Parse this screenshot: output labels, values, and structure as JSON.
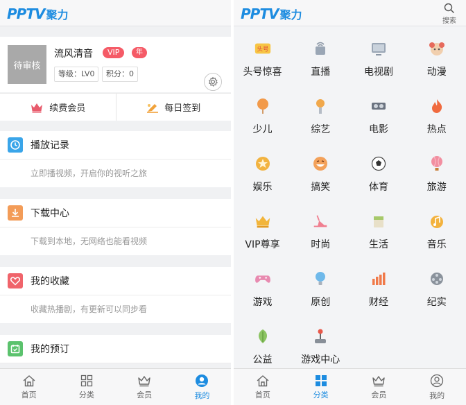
{
  "left": {
    "logo": {
      "brand": "PPTV",
      "sub": "聚力"
    },
    "profile": {
      "avatar_text": "待审核",
      "username": "流风清音",
      "vip_badge": "VIP",
      "year_badge": "年",
      "level": "等级：LV0",
      "points": "积分：0"
    },
    "actions": [
      {
        "label": "续费会员",
        "icon": "crown-icon"
      },
      {
        "label": "每日签到",
        "icon": "checkin-icon"
      }
    ],
    "sections": [
      {
        "title": "播放记录",
        "desc": "立即播视频，开启你的视听之旅",
        "icon": "clock-icon",
        "color": "#3aa5e9"
      },
      {
        "title": "下载中心",
        "desc": "下载到本地，无网络也能看视频",
        "icon": "download-icon",
        "color": "#f39c58"
      },
      {
        "title": "我的收藏",
        "desc": "收藏热播剧，有更新可以同步看",
        "icon": "heart-icon",
        "color": "#f0646b"
      },
      {
        "title": "我的预订",
        "icon": "calendar-icon",
        "color": "#5bc26d"
      }
    ],
    "tabs": [
      {
        "label": "首页",
        "icon": "home-icon"
      },
      {
        "label": "分类",
        "icon": "category-icon"
      },
      {
        "label": "会员",
        "icon": "crown-icon"
      },
      {
        "label": "我的",
        "icon": "user-icon"
      }
    ]
  },
  "right": {
    "logo": {
      "brand": "PPTV",
      "sub": "聚力"
    },
    "search_label": "搜索",
    "categories": [
      {
        "label": "头号惊喜",
        "icon": "surprise-icon"
      },
      {
        "label": "直播",
        "icon": "live-icon"
      },
      {
        "label": "电视剧",
        "icon": "tv-icon"
      },
      {
        "label": "动漫",
        "icon": "anime-icon"
      },
      {
        "label": "少儿",
        "icon": "kids-icon"
      },
      {
        "label": "综艺",
        "icon": "variety-icon"
      },
      {
        "label": "电影",
        "icon": "movie-icon"
      },
      {
        "label": "热点",
        "icon": "hot-icon"
      },
      {
        "label": "娱乐",
        "icon": "entertainment-icon"
      },
      {
        "label": "搞笑",
        "icon": "funny-icon"
      },
      {
        "label": "体育",
        "icon": "sports-icon"
      },
      {
        "label": "旅游",
        "icon": "travel-icon"
      },
      {
        "label": "VIP尊享",
        "icon": "vip-icon"
      },
      {
        "label": "时尚",
        "icon": "fashion-icon"
      },
      {
        "label": "生活",
        "icon": "life-icon"
      },
      {
        "label": "音乐",
        "icon": "music-icon"
      },
      {
        "label": "游戏",
        "icon": "game-icon"
      },
      {
        "label": "原创",
        "icon": "original-icon"
      },
      {
        "label": "财经",
        "icon": "finance-icon"
      },
      {
        "label": "纪实",
        "icon": "documentary-icon"
      },
      {
        "label": "公益",
        "icon": "charity-icon"
      },
      {
        "label": "游戏中心",
        "icon": "game-center-icon"
      }
    ],
    "tabs": [
      {
        "label": "首页",
        "icon": "home-icon"
      },
      {
        "label": "分类",
        "icon": "category-icon"
      },
      {
        "label": "会员",
        "icon": "crown-icon"
      },
      {
        "label": "我的",
        "icon": "user-icon"
      }
    ]
  },
  "colors": {
    "accent": "#1d8ce0",
    "badge": "#f55b67",
    "crown": "#e85b6c",
    "checkin": "#f1a23a"
  }
}
